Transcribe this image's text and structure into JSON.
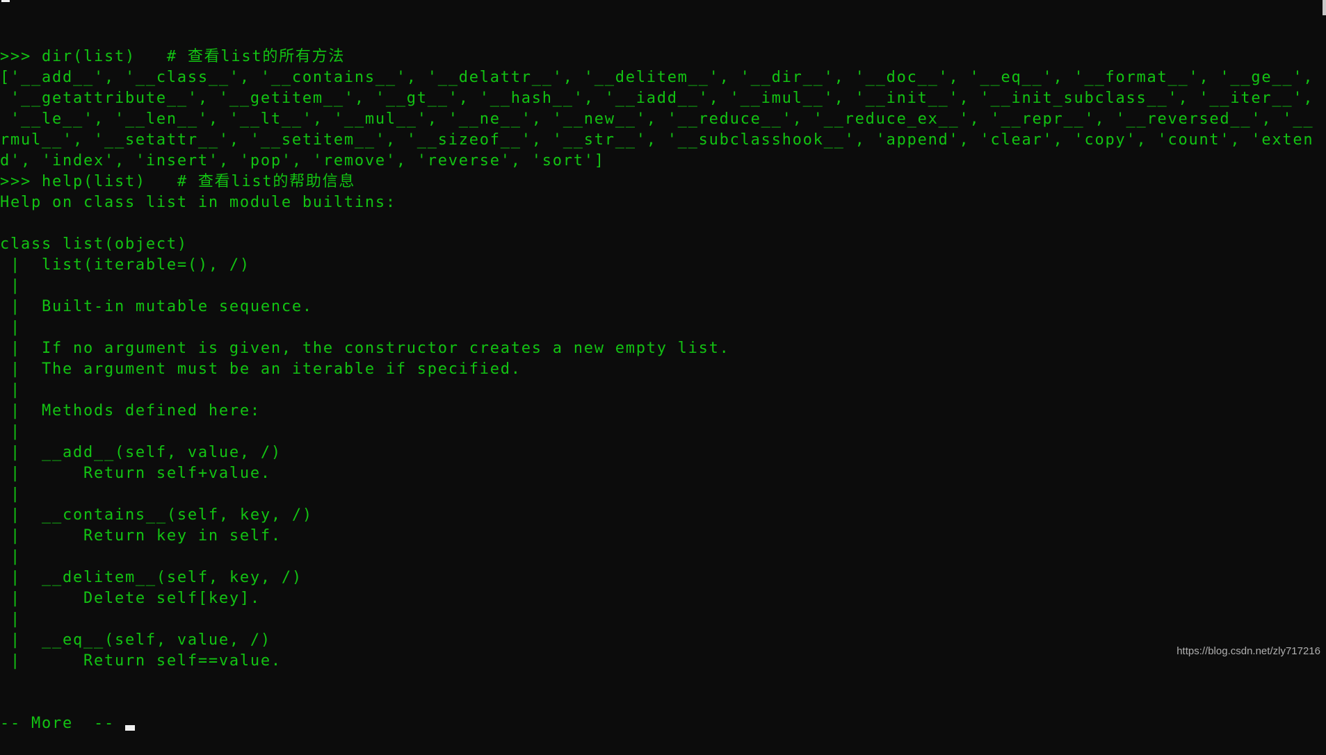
{
  "colors": {
    "background": "#0c0c0c",
    "text": "#13c313",
    "cursor": "#f0f0f0"
  },
  "terminal": {
    "lines": [
      ">>> dir(list)   # 查看list的所有方法",
      "['__add__', '__class__', '__contains__', '__delattr__', '__delitem__', '__dir__', '__doc__', '__eq__', '__format__', '__ge__',",
      " '__getattribute__', '__getitem__', '__gt__', '__hash__', '__iadd__', '__imul__', '__init__', '__init_subclass__', '__iter__',",
      " '__le__', '__len__', '__lt__', '__mul__', '__ne__', '__new__', '__reduce__', '__reduce_ex__', '__repr__', '__reversed__', '__",
      "rmul__', '__setattr__', '__setitem__', '__sizeof__', '__str__', '__subclasshook__', 'append', 'clear', 'copy', 'count', 'exten",
      "d', 'index', 'insert', 'pop', 'remove', 'reverse', 'sort']",
      ">>> help(list)   # 查看list的帮助信息",
      "Help on class list in module builtins:",
      "",
      "class list(object)",
      " |  list(iterable=(), /)",
      " |",
      " |  Built-in mutable sequence.",
      " |",
      " |  If no argument is given, the constructor creates a new empty list.",
      " |  The argument must be an iterable if specified.",
      " |",
      " |  Methods defined here:",
      " |",
      " |  __add__(self, value, /)",
      " |      Return self+value.",
      " |",
      " |  __contains__(self, key, /)",
      " |      Return key in self.",
      " |",
      " |  __delitem__(self, key, /)",
      " |      Delete self[key].",
      " |",
      " |  __eq__(self, value, /)",
      " |      Return self==value."
    ],
    "pager_prompt": "-- More  -- "
  },
  "watermark": "https://blog.csdn.net/zly717216"
}
